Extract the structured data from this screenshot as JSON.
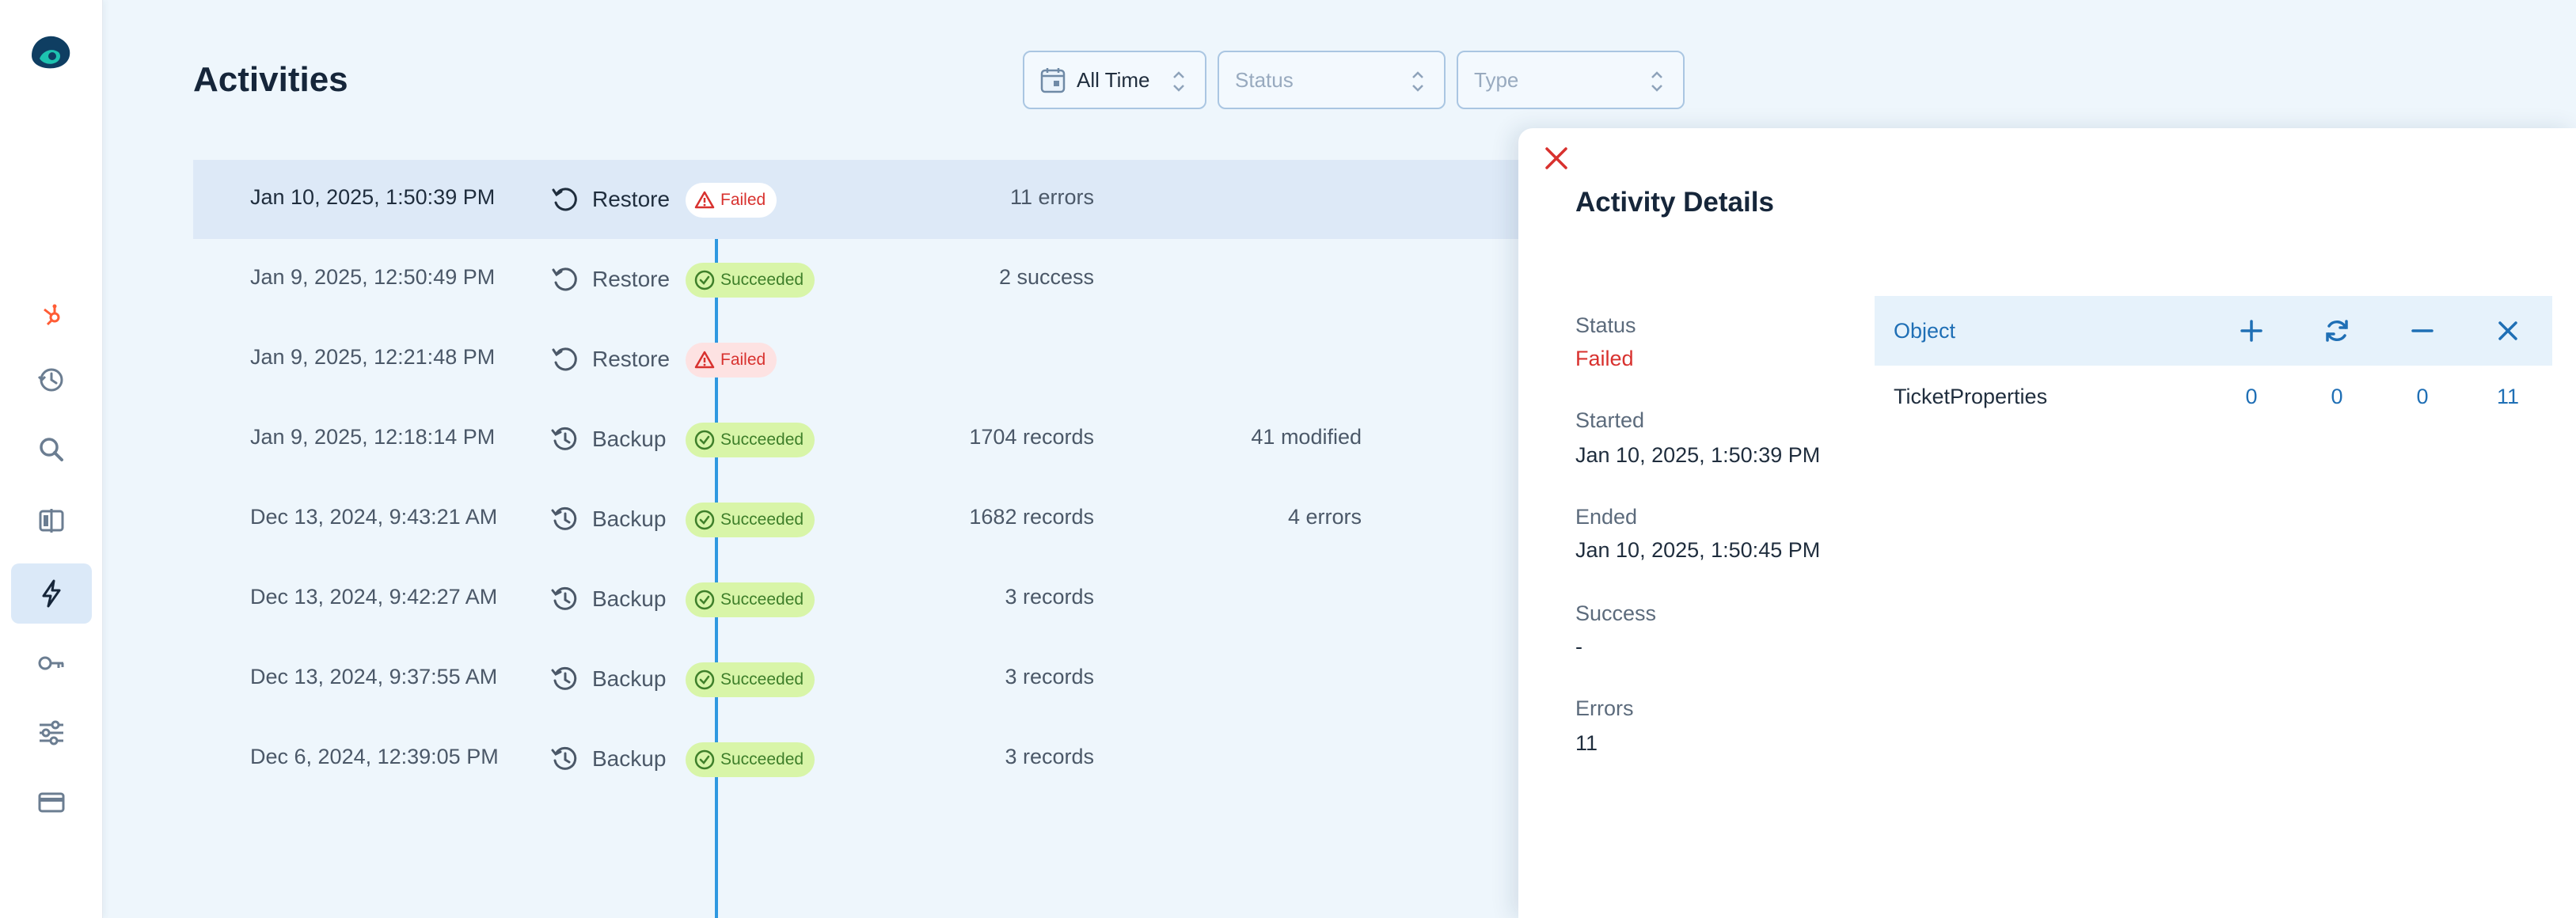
{
  "header": {
    "title": "Activities"
  },
  "filters": {
    "time": {
      "value": "All Time"
    },
    "status": {
      "placeholder": "Status"
    },
    "type": {
      "placeholder": "Type"
    }
  },
  "sidebar": {
    "items": [
      {
        "name": "hubspot-icon"
      },
      {
        "name": "history-icon"
      },
      {
        "name": "search-icon"
      },
      {
        "name": "compare-icon"
      },
      {
        "name": "activities-lightning-icon",
        "active": true
      },
      {
        "name": "key-icon"
      },
      {
        "name": "sliders-icon"
      },
      {
        "name": "card-icon"
      }
    ]
  },
  "activities": [
    {
      "date": "Jan 10, 2025, 1:50:39 PM",
      "type": "Restore",
      "status": "Failed",
      "col1": "11 errors",
      "col2": ""
    },
    {
      "date": "Jan 9, 2025, 12:50:49 PM",
      "type": "Restore",
      "status": "Succeeded",
      "col1": "2 success",
      "col2": ""
    },
    {
      "date": "Jan 9, 2025, 12:21:48 PM",
      "type": "Restore",
      "status": "Failed",
      "col1": "",
      "col2": ""
    },
    {
      "date": "Jan 9, 2025, 12:18:14 PM",
      "type": "Backup",
      "status": "Succeeded",
      "col1": "1704 records",
      "col2": "41 modified"
    },
    {
      "date": "Dec 13, 2024, 9:43:21 AM",
      "type": "Backup",
      "status": "Succeeded",
      "col1": "1682 records",
      "col2": "4 errors"
    },
    {
      "date": "Dec 13, 2024, 9:42:27 AM",
      "type": "Backup",
      "status": "Succeeded",
      "col1": "3 records",
      "col2": ""
    },
    {
      "date": "Dec 13, 2024, 9:37:55 AM",
      "type": "Backup",
      "status": "Succeeded",
      "col1": "3 records",
      "col2": ""
    },
    {
      "date": "Dec 6, 2024, 12:39:05 PM",
      "type": "Backup",
      "status": "Succeeded",
      "col1": "3 records",
      "col2": ""
    }
  ],
  "details": {
    "title": "Activity Details",
    "status_label": "Status",
    "status_value": "Failed",
    "started_label": "Started",
    "started_value": "Jan 10, 2025, 1:50:39 PM",
    "ended_label": "Ended",
    "ended_value": "Jan 10, 2025, 1:50:45 PM",
    "success_label": "Success",
    "success_value": "-",
    "errors_label": "Errors",
    "errors_value": "11",
    "table": {
      "header": "Object",
      "columns": [
        "plus-icon",
        "refresh-icon",
        "minus-icon",
        "x-icon"
      ],
      "rows": [
        {
          "name": "TicketProperties",
          "values": [
            "0",
            "0",
            "0",
            "11"
          ]
        }
      ]
    }
  },
  "colors": {
    "accent": "#2f98e0",
    "failed": "#d8312e",
    "succeeded": "#3e7f2a",
    "link": "#1f6fb5"
  }
}
